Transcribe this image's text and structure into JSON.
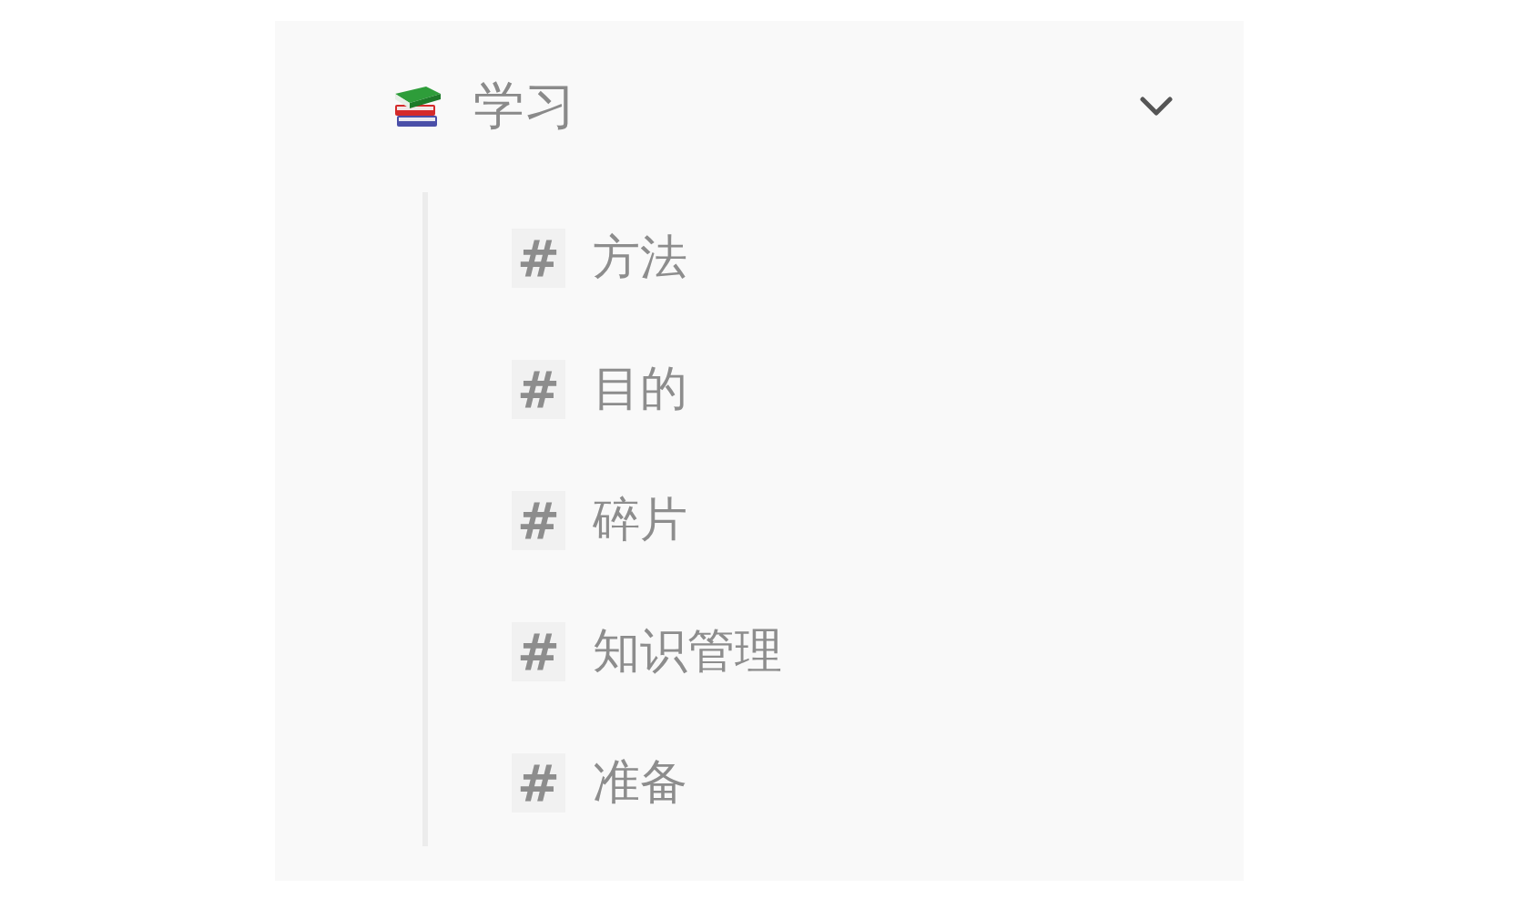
{
  "group": {
    "title": "学习",
    "expanded": true,
    "children": [
      {
        "hash": "#",
        "label": "方法"
      },
      {
        "hash": "#",
        "label": "目的"
      },
      {
        "hash": "#",
        "label": "碎片"
      },
      {
        "hash": "#",
        "label": "知识管理"
      },
      {
        "hash": "#",
        "label": "准备"
      }
    ]
  }
}
